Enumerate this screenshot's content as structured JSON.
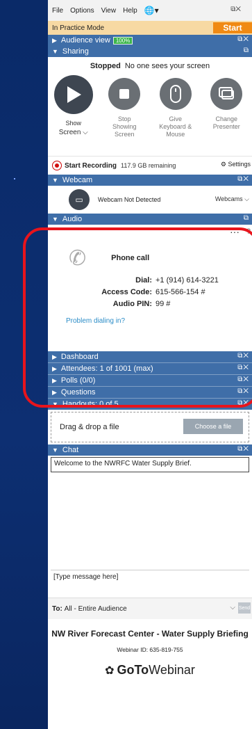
{
  "menu": {
    "items": [
      "File",
      "Options",
      "View",
      "Help"
    ]
  },
  "practice": {
    "text": "In Practice Mode",
    "start": "Start"
  },
  "audience_view": {
    "label": "Audience view",
    "pct": "100%"
  },
  "sharing": {
    "header": "Sharing",
    "status_bold": "Stopped",
    "status_text": "No one sees your screen",
    "buttons": [
      {
        "label1": "Show",
        "label2": "Screen ⌵"
      },
      {
        "label1": "Stop",
        "label2": "Showing",
        "label3": "Screen"
      },
      {
        "label1": "Give",
        "label2": "Keyboard &",
        "label3": "Mouse"
      },
      {
        "label1": "Change",
        "label2": "Presenter"
      }
    ]
  },
  "recording": {
    "label": "Start Recording",
    "remaining": "117.9 GB remaining",
    "settings": "Settings"
  },
  "webcam": {
    "header": "Webcam",
    "status": "Webcam Not Detected",
    "menu": "Webcams ⌵"
  },
  "audio": {
    "header": "Audio",
    "more": "···",
    "help": "?",
    "mode": "Phone call",
    "dial_label": "Dial:",
    "dial_value": "+1 (914) 614-3221",
    "code_label": "Access Code:",
    "code_value": "615-566-154 #",
    "pin_label": "Audio PIN:",
    "pin_value": "99 #",
    "problem": "Problem dialing in?"
  },
  "sections": {
    "dashboard": "Dashboard",
    "attendees": "Attendees: 1 of 1001 (max)",
    "polls": "Polls (0/0)",
    "questions": "Questions",
    "handouts": "Handouts: 0 of 5",
    "chat": "Chat"
  },
  "handouts": {
    "drop": "Drag & drop a file",
    "choose": "Choose a file"
  },
  "chat": {
    "welcome": "Welcome to the NWRFC Water Supply Brief.",
    "placeholder": "[Type message here]",
    "to_label": "To:",
    "to_value": "All - Entire Audience",
    "send": "Send"
  },
  "webinar": {
    "title": "NW River Forecast Center - Water Supply Briefing",
    "id": "Webinar ID: 635-819-755",
    "logo_bold": "GoTo",
    "logo_rest": "Webinar"
  }
}
